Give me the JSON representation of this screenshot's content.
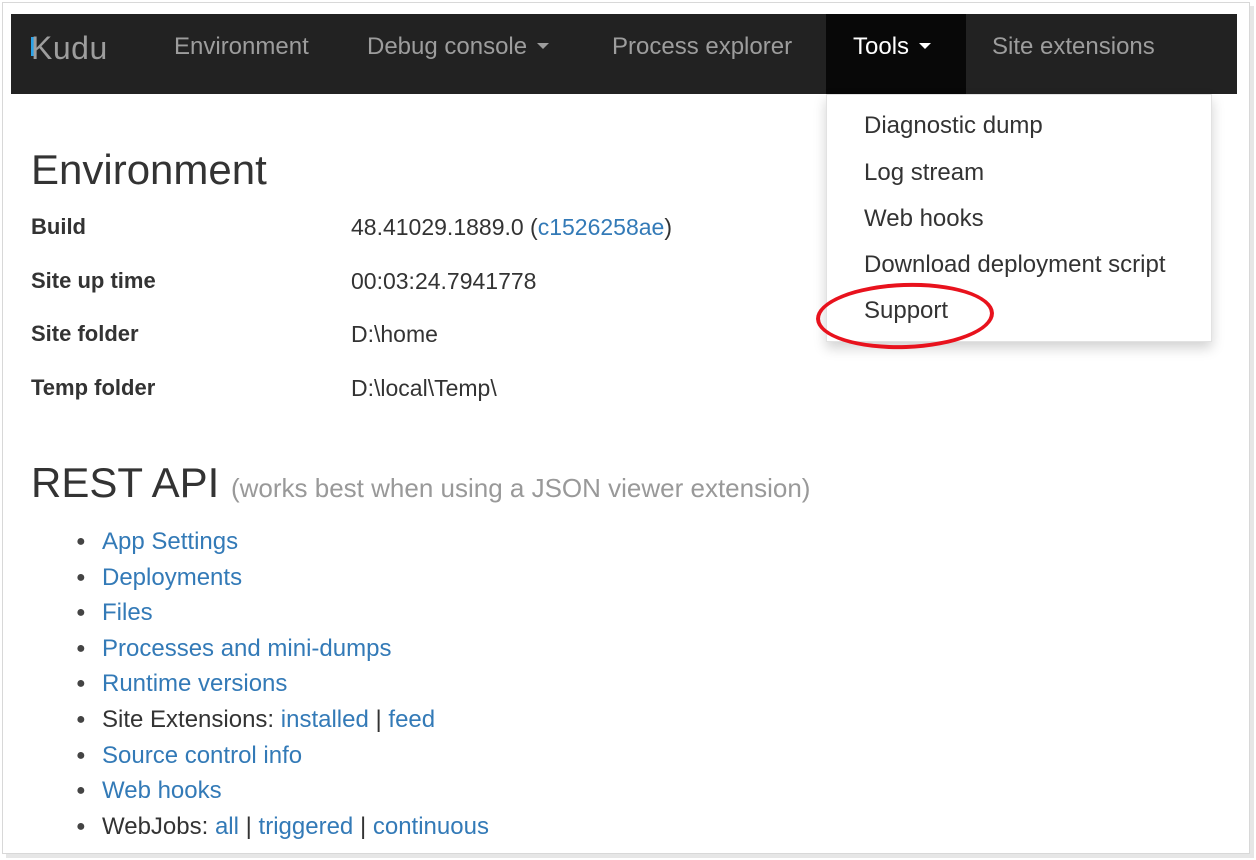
{
  "navbar": {
    "brand": "Kudu",
    "items": [
      {
        "label": "Environment",
        "has_caret": false
      },
      {
        "label": "Debug console",
        "has_caret": true
      },
      {
        "label": "Process explorer",
        "has_caret": false
      },
      {
        "label": "Tools",
        "has_caret": true,
        "active": true
      },
      {
        "label": "Site extensions",
        "has_caret": false
      }
    ]
  },
  "tools_menu": {
    "items": [
      "Diagnostic dump",
      "Log stream",
      "Web hooks",
      "Download deployment script",
      "Support"
    ],
    "highlighted": "Support"
  },
  "environment": {
    "title": "Environment",
    "rows": [
      {
        "label": "Build",
        "value": "48.41029.1889.0 (",
        "link": "c1526258ae",
        "suffix": ")"
      },
      {
        "label": "Site up time",
        "value": "00:03:24.7941778"
      },
      {
        "label": "Site folder",
        "value": "D:\\home"
      },
      {
        "label": "Temp folder",
        "value": "D:\\local\\Temp\\"
      }
    ]
  },
  "rest_api": {
    "title": "REST API",
    "hint": "(works best when using a JSON viewer extension)",
    "items": [
      {
        "link": "App Settings"
      },
      {
        "link": "Deployments"
      },
      {
        "link": "Files"
      },
      {
        "link": "Processes and mini-dumps"
      },
      {
        "link": "Runtime versions"
      },
      {
        "prefix": "Site Extensions: ",
        "links": [
          "installed",
          "feed"
        ]
      },
      {
        "link": "Source control info"
      },
      {
        "link": "Web hooks"
      },
      {
        "prefix": "WebJobs: ",
        "links": [
          "all",
          "triggered",
          "continuous"
        ]
      }
    ]
  },
  "colors": {
    "navbar_bg": "#222222",
    "navbar_active_bg": "#080808",
    "link": "#337ab7",
    "highlight_ring": "#e8121d",
    "brand_accent": "#2aa2e8"
  }
}
